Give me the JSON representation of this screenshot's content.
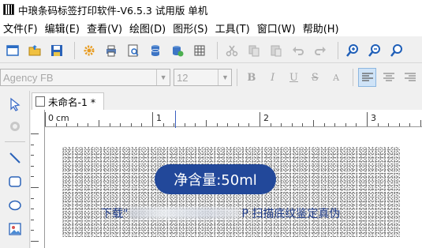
{
  "window": {
    "title": "中琅条码标签打印软件-V6.5.3 试用版 单机"
  },
  "menu": {
    "items": [
      "文件(F)",
      "编辑(E)",
      "查看(V)",
      "绘图(D)",
      "图形(S)",
      "工具(T)",
      "窗口(W)",
      "帮助(H)"
    ]
  },
  "toolbar": {
    "icons": [
      "new-icon",
      "open-icon",
      "save-icon",
      "settings-icon",
      "print-icon",
      "print-preview-icon",
      "database-icon",
      "database-settings-icon",
      "grid-icon",
      "cut-icon",
      "copy-icon",
      "paste-icon",
      "undo-icon",
      "redo-icon",
      "zoom-in-icon",
      "zoom-out-icon",
      "zoom-fit-icon"
    ]
  },
  "format": {
    "font_name": "Agency FB",
    "font_size": "12",
    "bold_label": "B",
    "italic_label": "I",
    "underline_label": "U",
    "strike_label": "S",
    "sub_label": "A"
  },
  "document": {
    "tab_title": "未命名-1 *"
  },
  "ruler": {
    "unit": "cm",
    "labels": [
      "0",
      "1",
      "2",
      "3"
    ]
  },
  "label": {
    "net_content": "净含量:50ml",
    "caption_prefix": "下载\"",
    "caption_suffix": "P 扫描底纹鉴定真伪"
  },
  "colors": {
    "pill_bg": "#22489a",
    "caption_text": "#213e8c",
    "accent_marker": "#3b5fc0"
  }
}
